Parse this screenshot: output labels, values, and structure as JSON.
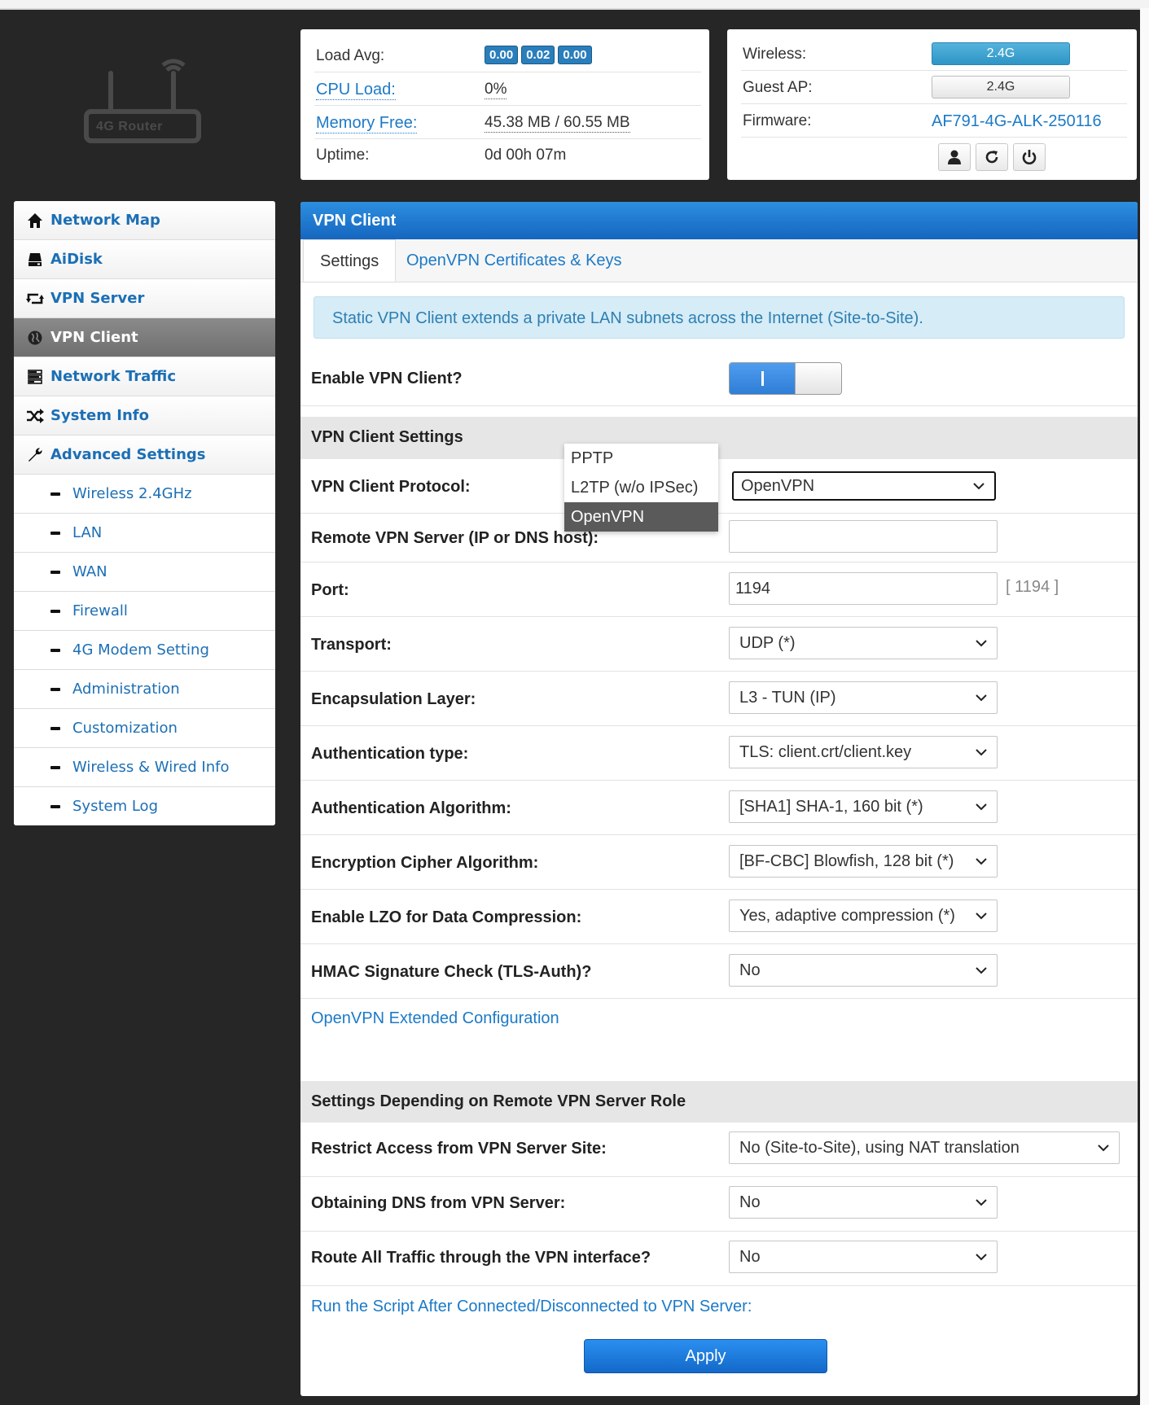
{
  "logo": {
    "text": "4G Router"
  },
  "status": {
    "load_avg_label": "Load Avg:",
    "load_avg": [
      "0.00",
      "0.02",
      "0.00"
    ],
    "cpu_label": "CPU Load:",
    "cpu_value": "0%",
    "mem_label": "Memory Free:",
    "mem_value": "45.38 MB / 60.55 MB",
    "uptime_label": "Uptime:",
    "uptime_value": "0d 00h 07m",
    "wireless_label": "Wireless:",
    "wireless_value": "2.4G",
    "guest_label": "Guest AP:",
    "guest_value": "2.4G",
    "firmware_label": "Firmware:",
    "firmware_value": "AF791-4G-ALK-250116"
  },
  "sidebar": {
    "items": [
      {
        "label": "Network Map",
        "icon": "home-icon"
      },
      {
        "label": "AiDisk",
        "icon": "disk-icon"
      },
      {
        "label": "VPN Server",
        "icon": "retweet-icon"
      },
      {
        "label": "VPN Client",
        "icon": "globe-icon"
      },
      {
        "label": "Network Traffic",
        "icon": "tasks-icon"
      },
      {
        "label": "System Info",
        "icon": "random-icon"
      },
      {
        "label": "Advanced Settings",
        "icon": "wrench-icon"
      }
    ],
    "subitems": [
      "Wireless 2.4GHz",
      "LAN",
      "WAN",
      "Firewall",
      "4G Modem Setting",
      "Administration",
      "Customization",
      "Wireless & Wired Info",
      "System Log"
    ]
  },
  "main": {
    "title": "VPN Client",
    "tabs": [
      "Settings",
      "OpenVPN Certificates & Keys"
    ],
    "info": "Static VPN Client extends a private LAN subnets across the Internet (Site-to-Site).",
    "enable_label": "Enable VPN Client?",
    "section1": "VPN Client Settings",
    "protocol_label": "VPN Client Protocol:",
    "protocol_value": "OpenVPN",
    "protocol_options": [
      "PPTP",
      "L2TP (w/o IPSec)",
      "OpenVPN"
    ],
    "remote_label": "Remote VPN Server (IP or DNS host):",
    "remote_value": "",
    "port_label": "Port:",
    "port_value": "1194",
    "port_hint": "[ 1194 ]",
    "transport_label": "Transport:",
    "transport_value": "UDP (*)",
    "encap_label": "Encapsulation Layer:",
    "encap_value": "L3 - TUN (IP)",
    "auth_type_label": "Authentication type:",
    "auth_type_value": "TLS: client.crt/client.key",
    "auth_alg_label": "Authentication Algorithm:",
    "auth_alg_value": "[SHA1] SHA-1, 160 bit (*)",
    "cipher_label": "Encryption Cipher Algorithm:",
    "cipher_value": "[BF-CBC] Blowfish, 128 bit (*)",
    "lzo_label": "Enable LZO for Data Compression:",
    "lzo_value": "Yes, adaptive compression (*)",
    "hmac_label": "HMAC Signature Check (TLS-Auth)?",
    "hmac_value": "No",
    "ext_config_link": "OpenVPN Extended Configuration",
    "section2": "Settings Depending on Remote VPN Server Role",
    "restrict_label": "Restrict Access from VPN Server Site:",
    "restrict_value": "No (Site-to-Site), using NAT translation",
    "dns_label": "Obtaining DNS from VPN Server:",
    "dns_value": "No",
    "route_label": "Route All Traffic through the VPN interface?",
    "route_value": "No",
    "script_link": "Run the Script After Connected/Disconnected to VPN Server:",
    "apply_label": "Apply"
  }
}
